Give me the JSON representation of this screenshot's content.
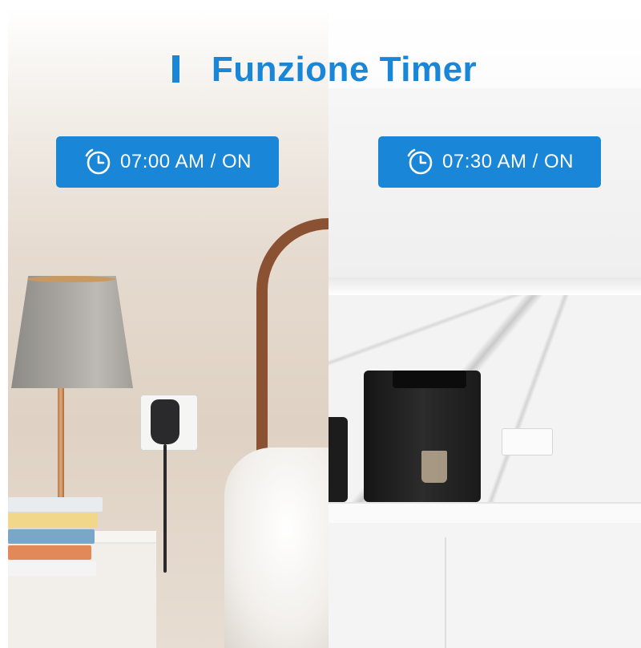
{
  "title": "Funzione Timer",
  "colors": {
    "accent": "#1a86d8",
    "badge_text": "#ffffff"
  },
  "timers": [
    {
      "label": "07:00 AM / ON",
      "icon": "clock-icon"
    },
    {
      "label": "07:30 AM / ON",
      "icon": "clock-icon"
    }
  ],
  "scenes": {
    "left": "bedroom-with-lamp",
    "right": "kitchen-with-coffee-machine"
  }
}
